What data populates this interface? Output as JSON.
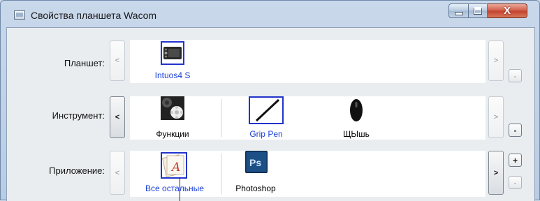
{
  "window": {
    "title": "Свойства планшета Wacom"
  },
  "rows": {
    "tablet": {
      "label": "Планшет:",
      "items": [
        {
          "label": "Intuos4 S",
          "selected": true
        }
      ]
    },
    "tool": {
      "label": "Инструмент:",
      "items": [
        {
          "label": "Функции",
          "selected": false
        },
        {
          "label": "Grip Pen",
          "selected": true
        },
        {
          "label": "ЩЫшь",
          "selected": false
        }
      ]
    },
    "app": {
      "label": "Приложение:",
      "items": [
        {
          "label": "Все остальные",
          "selected": true
        },
        {
          "label": "Photoshop",
          "selected": false
        }
      ]
    }
  },
  "glyphs": {
    "left": "<",
    "right": ">",
    "plus": "+",
    "minus": "-",
    "close": "X",
    "ps": "Ps"
  },
  "colors": {
    "selection": "#2233cc",
    "selected_text": "#1a3fd6"
  }
}
